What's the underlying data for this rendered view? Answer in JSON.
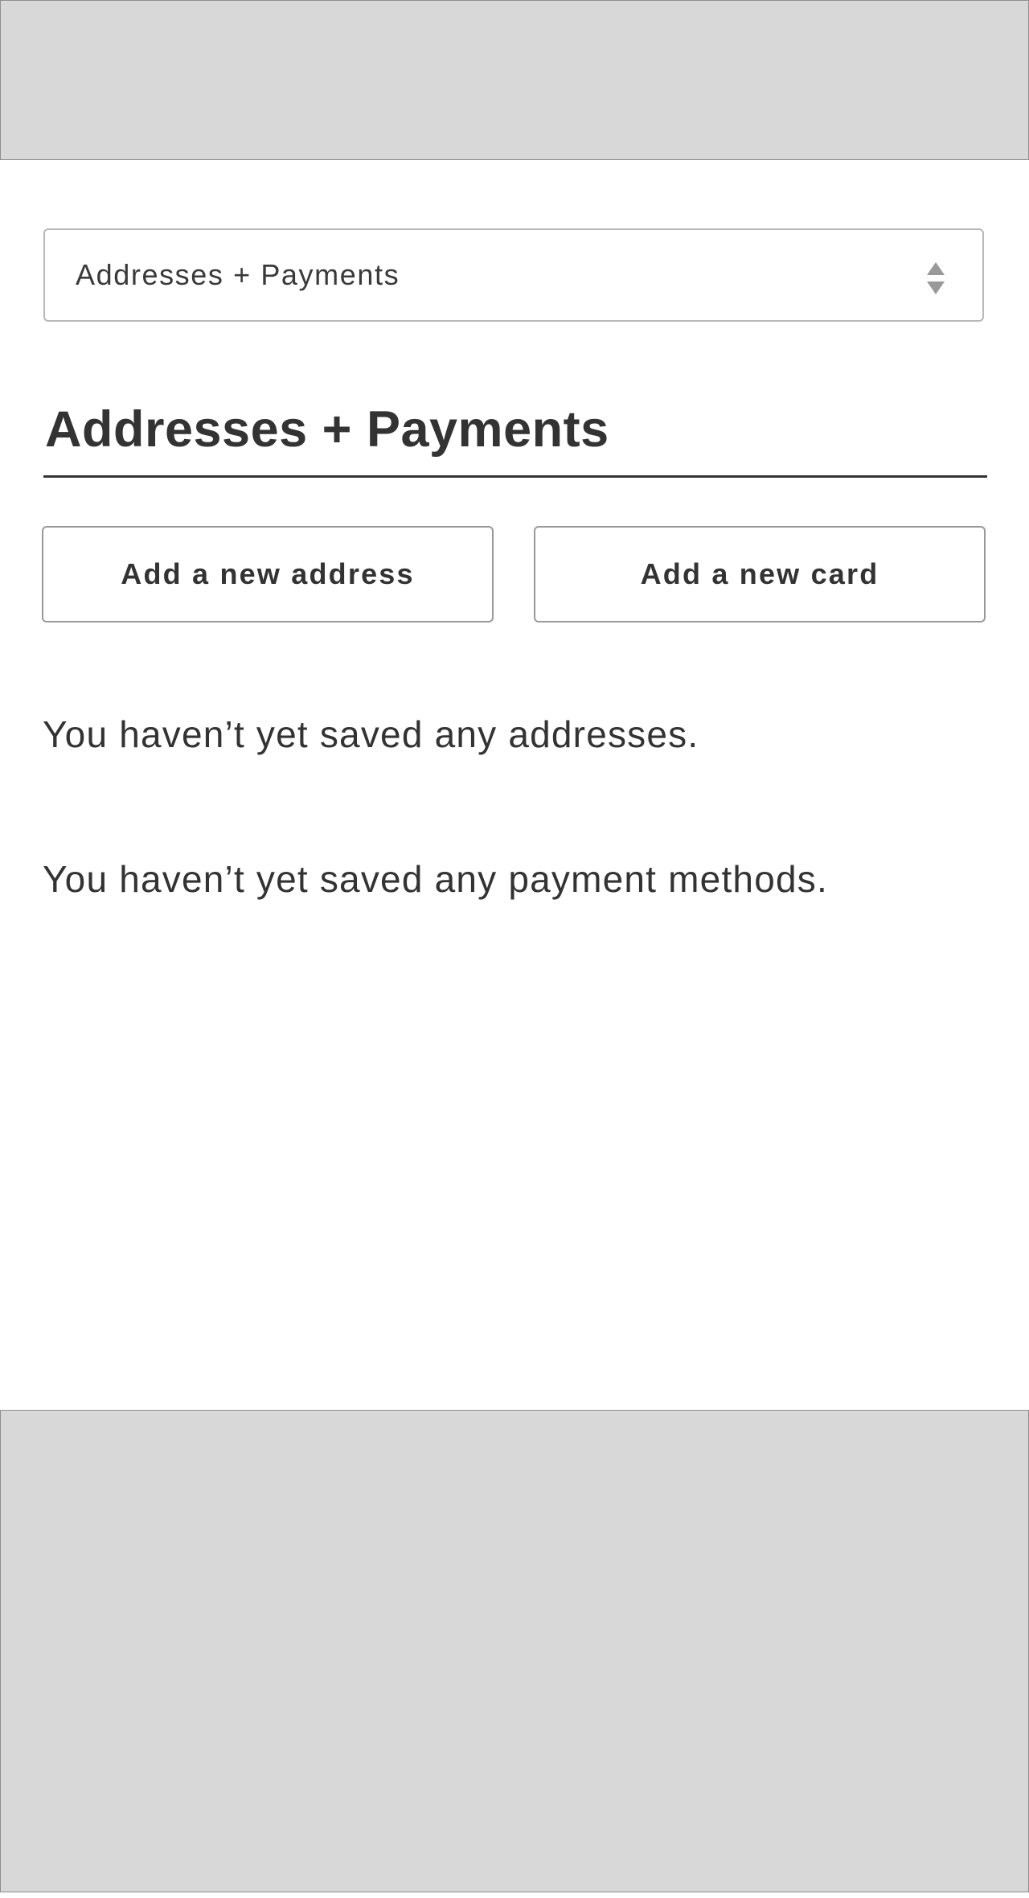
{
  "section_select": {
    "selected": "Addresses + Payments"
  },
  "page": {
    "title": "Addresses + Payments"
  },
  "actions": {
    "add_address_label": "Add a new address",
    "add_card_label": "Add a new card"
  },
  "messages": {
    "no_addresses": "You haven’t yet saved any addresses.",
    "no_payments": "You haven’t yet saved any payment methods."
  },
  "icons": {
    "select_arrows": "up-down-arrows-icon"
  },
  "colors": {
    "text": "#333333",
    "placeholder_fill": "#d8d8d8",
    "border": "#b8b8b8"
  }
}
